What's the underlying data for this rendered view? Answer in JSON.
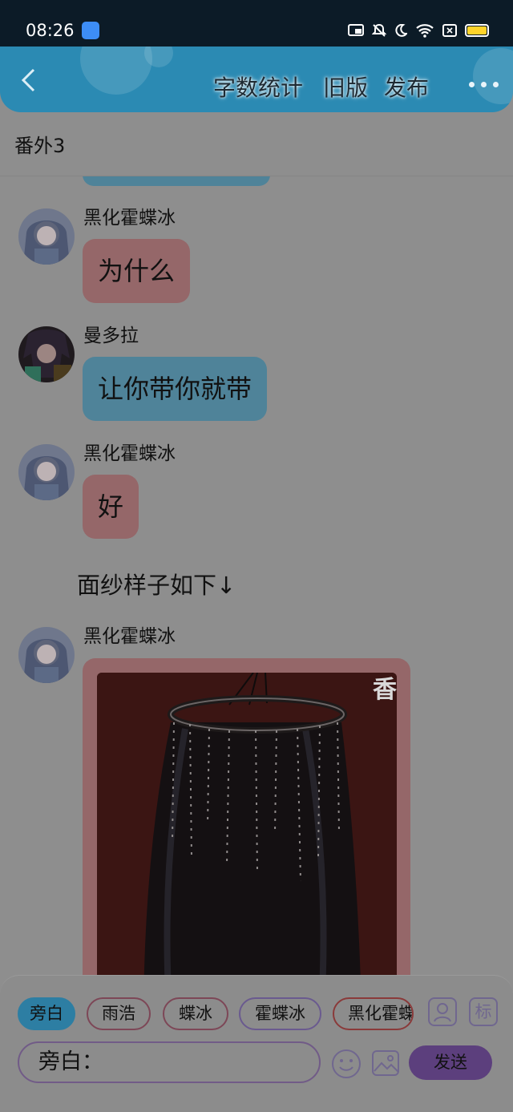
{
  "status_bar": {
    "time": "08:26",
    "battery_color": "#ffd42a"
  },
  "header": {
    "back_icon": "chevron-left-icon",
    "word_count": "字数统计",
    "old_version": "旧版",
    "publish": "发布",
    "more_icon": "more-dots-icon"
  },
  "chapter": {
    "title": "番外3"
  },
  "messages": [
    {
      "name": "黑化霍蝶冰",
      "text": "为什么",
      "color": "pink"
    },
    {
      "name": "曼多拉",
      "text": "让你带你就带",
      "color": "blue"
    },
    {
      "name": "黑化霍蝶冰",
      "text": "好",
      "color": "pink"
    }
  ],
  "narration": "面纱样子如下↓",
  "image_message": {
    "name": "黑化霍蝶冰",
    "corner_text": "香"
  },
  "bottom": {
    "chips": [
      "旁白",
      "雨浩",
      "蝶冰",
      "霍蝶冰",
      "黑化霍蝶冰"
    ],
    "icon_user": "user-card-icon",
    "icon_tag": "标",
    "input_value": "旁白：",
    "emoji_icon": "emoji-icon",
    "image_icon": "image-icon",
    "send_label": "发送"
  },
  "colors": {
    "pink_bubble": "#956769",
    "blue_bubble": "#4f8399",
    "header": "#2b8ab3",
    "send_button": "#5c3f7d"
  }
}
